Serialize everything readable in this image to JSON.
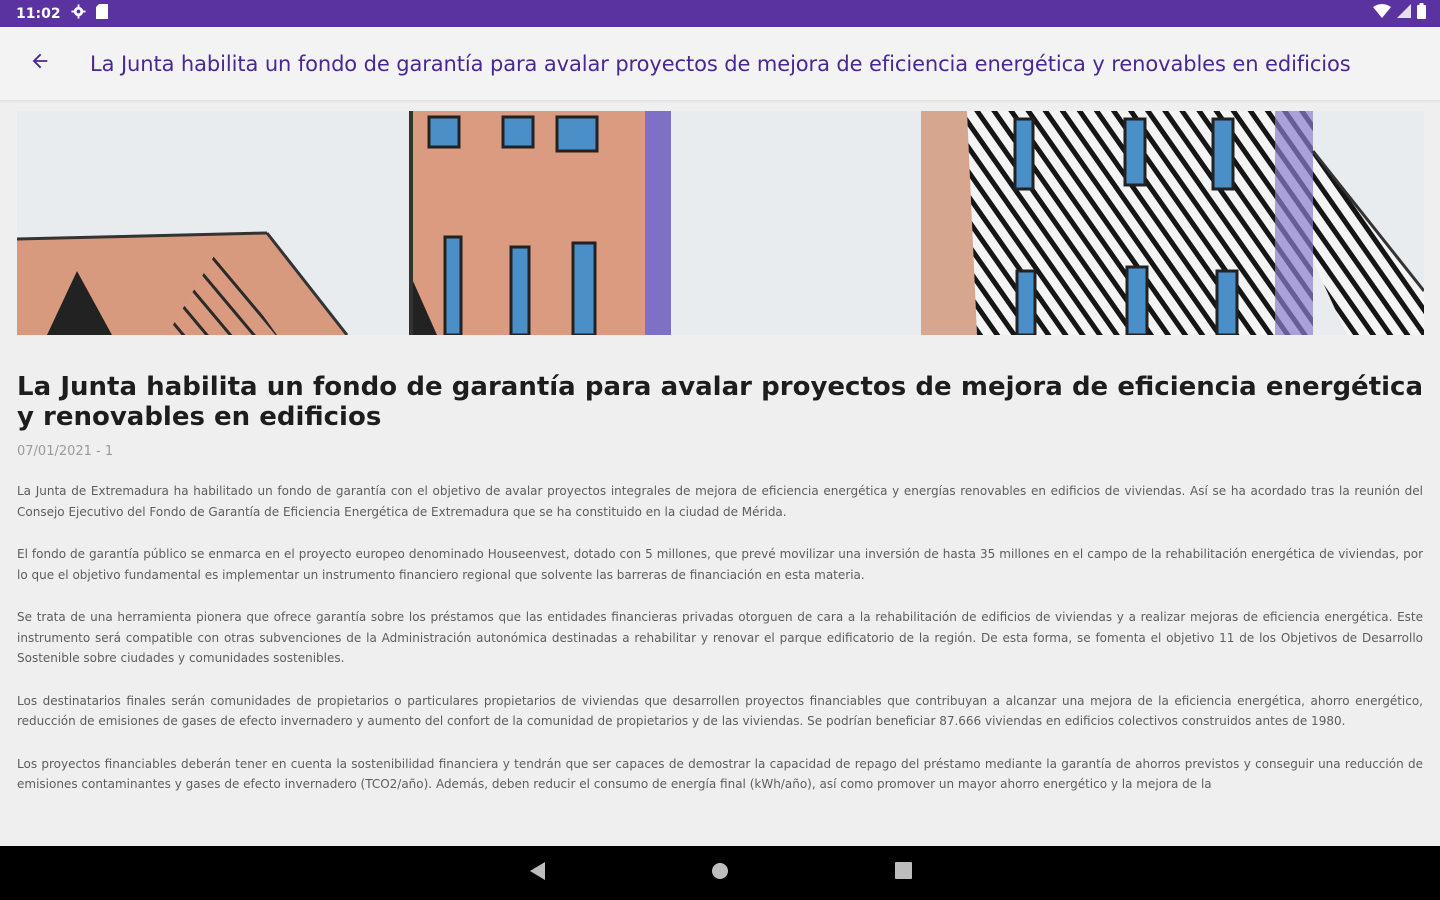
{
  "status_bar": {
    "time": "11:02",
    "icons": [
      "gear-icon",
      "sd-card-icon",
      "wifi-icon",
      "signal-icon",
      "battery-icon"
    ]
  },
  "app_bar": {
    "back_icon": "arrow-back-icon",
    "title": "La Junta habilita un fondo de garantía para avalar proyectos de mejora de eficiencia energética y renovables en edificios"
  },
  "article": {
    "image_alt": "building-illustration",
    "headline": "La Junta habilita un fondo de garantía para avalar proyectos de mejora de eficiencia energética y renovables en edificios",
    "meta": "07/01/2021 - 1",
    "paragraphs": [
      "La Junta de Extremadura ha habilitado un fondo de garantía con el objetivo de avalar proyectos integrales de mejora de eficiencia energética y energías renovables en edificios de viviendas. Así se ha acordado tras la reunión del Consejo Ejecutivo del Fondo de Garantía de Eficiencia Energética de Extremadura que se ha constituido en la ciudad de Mérida.",
      "El fondo de garantía público se enmarca en el proyecto europeo denominado Houseenvest, dotado con 5 millones, que prevé movilizar una inversión de hasta 35 millones en el campo de la rehabilitación energética de viviendas, por lo que el objetivo fundamental es implementar un instrumento financiero regional que solvente las barreras de financiación en esta materia.",
      "Se trata de una herramienta pionera que ofrece garantía sobre los préstamos que las entidades financieras privadas otorguen de cara a la rehabilitación de edificios de viviendas y a realizar mejoras de eficiencia energética. Este instrumento será compatible con otras subvenciones de la Administración autonómica destinadas a rehabilitar y renovar el parque edificatorio de la región. De esta forma, se fomenta el objetivo 11 de los Objetivos de Desarrollo Sostenible sobre ciudades y comunidades sostenibles.",
      "Los destinatarios finales serán comunidades de propietarios o particulares propietarios de viviendas que desarrollen proyectos financiables que contribuyan a alcanzar una mejora de la eficiencia energética, ahorro energético, reducción de emisiones de gases de efecto invernadero y aumento del confort de la comunidad de propietarios y de las viviendas. Se podrían beneficiar 87.666 viviendas en edificios colectivos construidos antes de 1980.",
      "Los proyectos financiables deberán tener en cuenta la sostenibilidad financiera y tendrán que ser capaces de demostrar la capacidad de repago del préstamo mediante la garantía de ahorros previstos y conseguir una reducción de emisiones contaminantes y gases de efecto invernadero (TCO2/año). Además, deben reducir el consumo de energía final (kWh/año), así como promover un mayor ahorro energético y la mejora de la"
    ]
  },
  "nav_bar": {
    "back": "nav-back-icon",
    "home": "nav-home-icon",
    "recents": "nav-recents-icon"
  },
  "colors": {
    "status_bar": "#5a33a0",
    "title": "#4a2796",
    "background": "#efefef"
  }
}
